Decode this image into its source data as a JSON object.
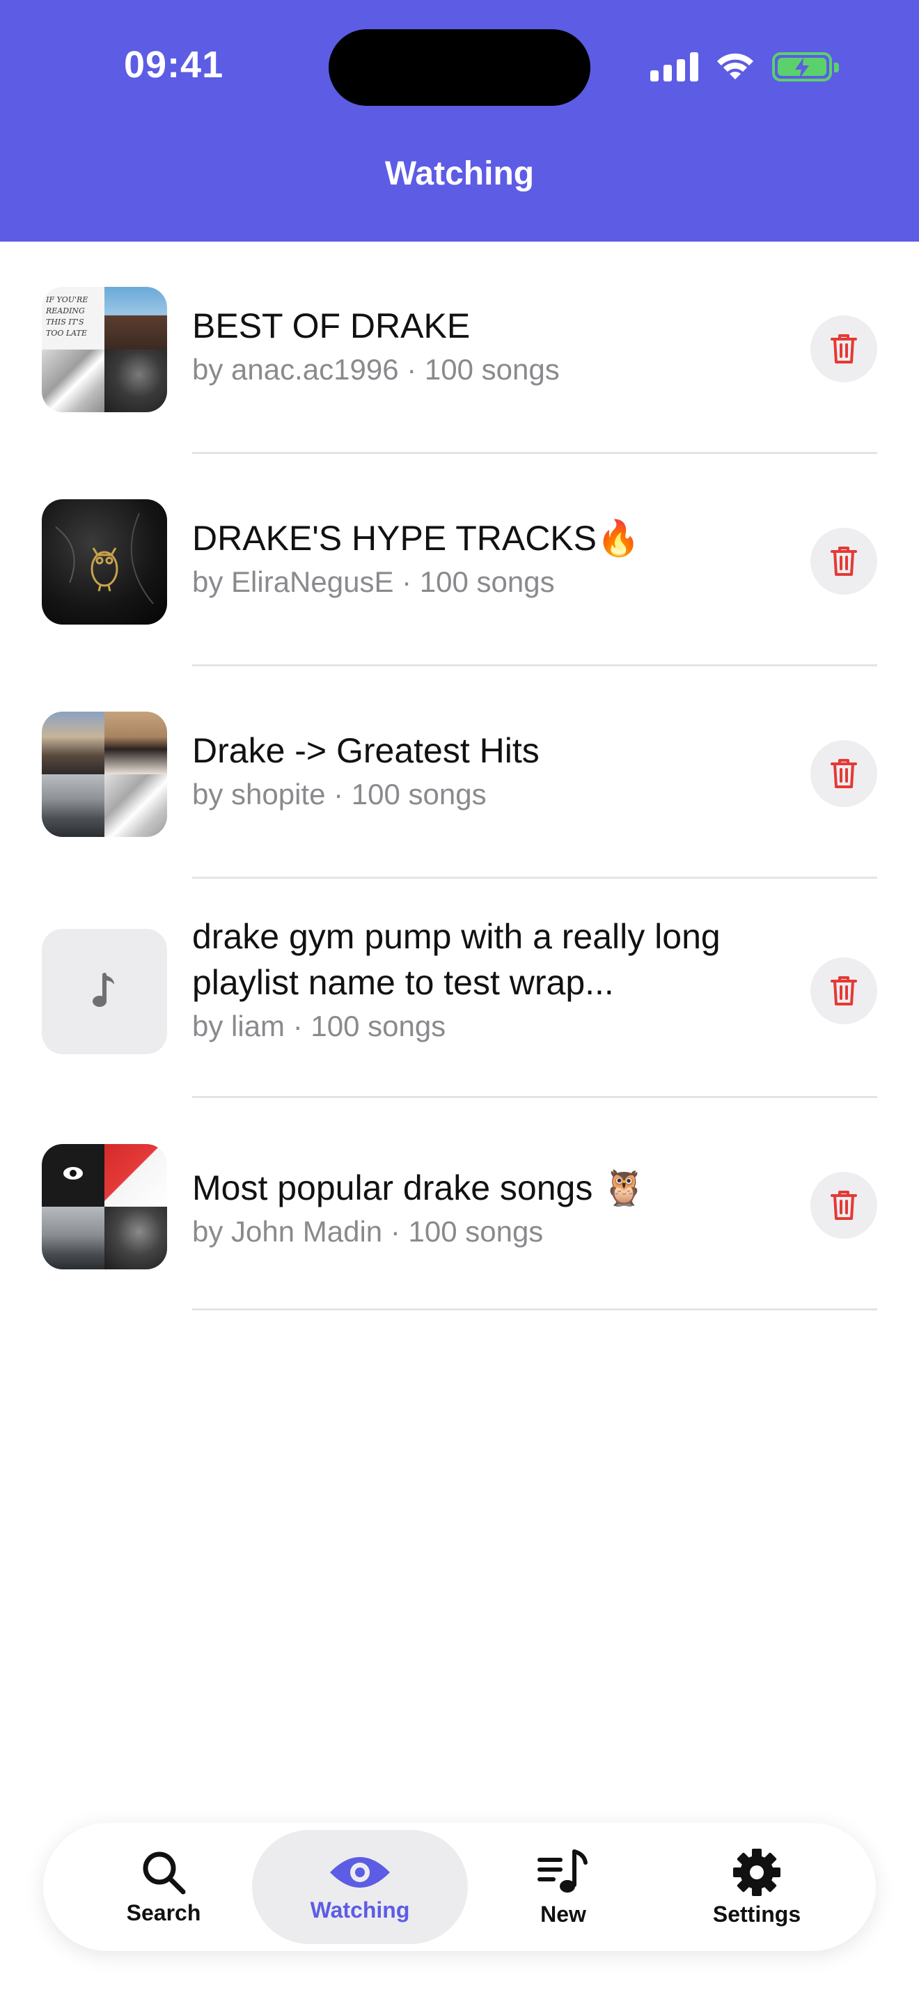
{
  "status_bar": {
    "time": "09:41"
  },
  "header": {
    "title": "Watching"
  },
  "playlists": [
    {
      "title": "BEST OF DRAKE",
      "subtitle": "by anac.ac1996 · 100 songs"
    },
    {
      "title": "DRAKE'S HYPE TRACKS🔥",
      "subtitle": "by EliraNegusE · 100 songs"
    },
    {
      "title": "Drake -> Greatest Hits",
      "subtitle": "by shopite · 100 songs"
    },
    {
      "title": "drake gym pump with a really long playlist name to test wrap...",
      "subtitle": "by liam · 100 songs"
    },
    {
      "title": "Most popular drake songs 🦉",
      "subtitle": "by John Madin · 100 songs"
    }
  ],
  "thumb_text": {
    "cover_note": "IF YOU'RE READING THIS IT'S TOO LATE"
  },
  "tabs": [
    {
      "label": "Search",
      "icon": "search-icon"
    },
    {
      "label": "Watching",
      "icon": "eye-icon",
      "active": true
    },
    {
      "label": "New",
      "icon": "music-list-icon"
    },
    {
      "label": "Settings",
      "icon": "gear-icon"
    }
  ],
  "colors": {
    "accent": "#5d5ce5",
    "delete": "#e53935",
    "subtitle": "#8a8a8e",
    "battery": "#5ad16a"
  }
}
